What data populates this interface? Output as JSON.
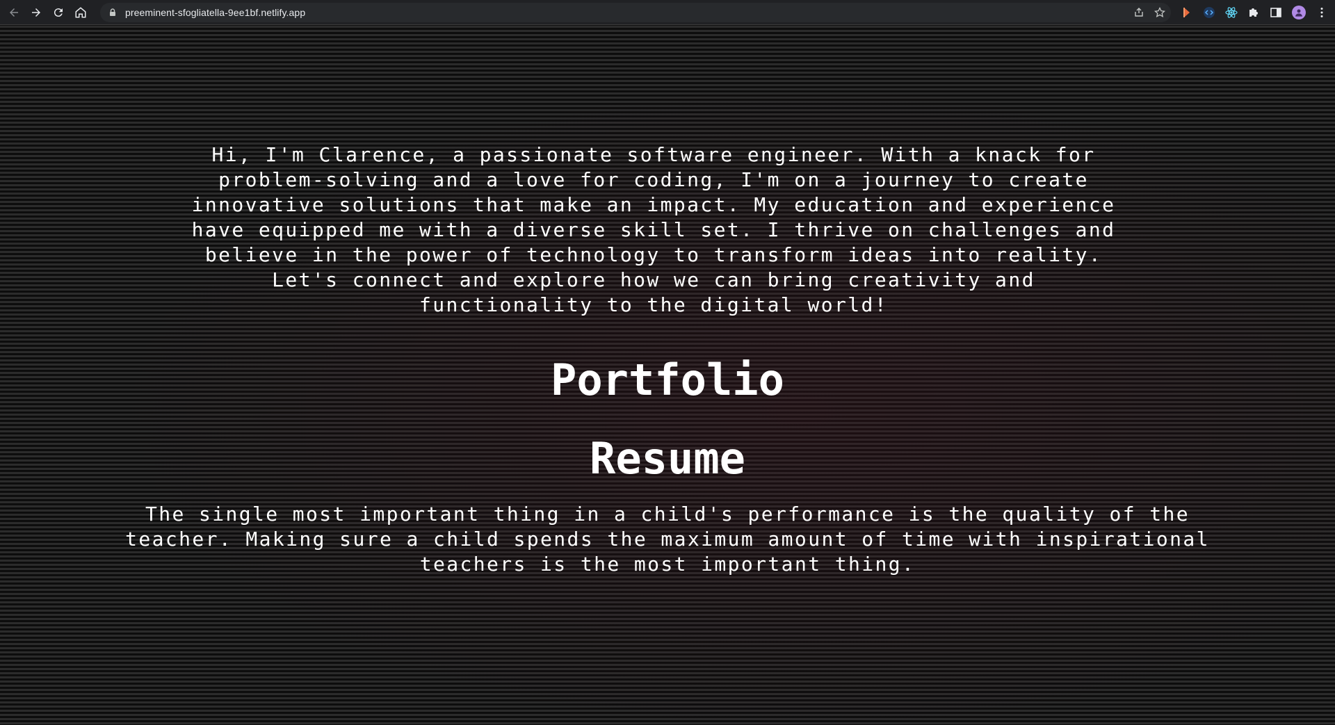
{
  "browser": {
    "url": "preeminent-sfogliatella-9ee1bf.netlify.app",
    "nav_icons": [
      "back-arrow-icon",
      "forward-arrow-icon",
      "reload-icon",
      "home-icon"
    ],
    "toolbar_icons": [
      "share-icon",
      "bookmark-star-icon"
    ],
    "extension_icons": [
      "extension-flag-icon",
      "extension-code-icon",
      "react-devtools-icon",
      "puzzle-icon",
      "sidepanel-icon",
      "profile-avatar-icon",
      "menu-kebab-icon"
    ],
    "colors": {
      "chrome_bg": "#202124",
      "omnibox_bg": "#282a2d",
      "avatar": "#b18ae6"
    }
  },
  "page": {
    "intro": "Hi, I'm Clarence, a passionate software engineer. With a knack for problem-solving and a love for coding, I'm on a journey to create innovative solutions that make an impact. My education and experience have equipped me with a diverse skill set. I thrive on challenges and believe in the power of technology to transform ideas into reality. Let's connect and explore how we can bring creativity and functionality to the digital world!",
    "portfolio_heading": "Portfolio",
    "resume_heading": "Resume",
    "quote": "The single most important thing in a child's performance is the quality of the teacher. Making sure a child spends the maximum amount of time with inspirational teachers is the most important thing.",
    "colors": {
      "text": "#ffffff",
      "background": "#121212",
      "scanline": "#2b2b2b"
    }
  }
}
